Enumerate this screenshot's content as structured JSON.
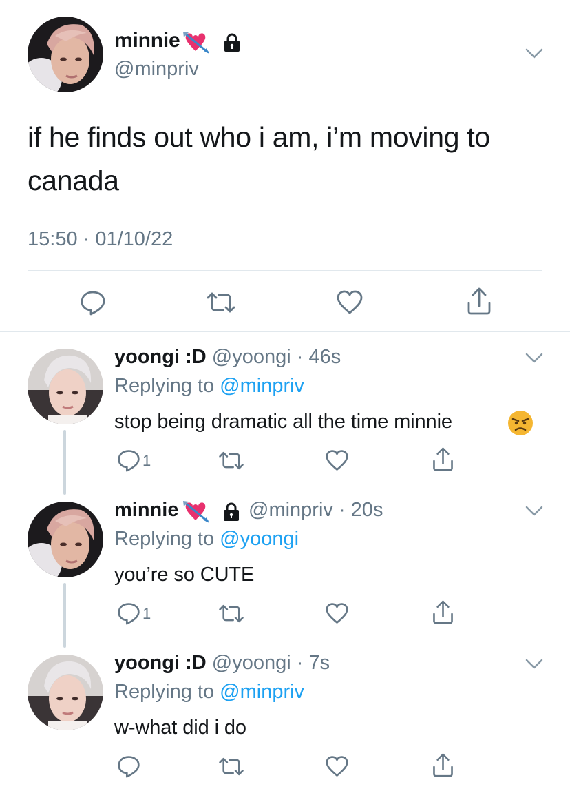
{
  "main": {
    "name": "minnie",
    "handle": "@minpriv",
    "text": "if he finds out who i am, i’m moving to canada",
    "timestamp": "15:50 · 01/10/22",
    "name_emoji": "heart-with-arrow",
    "lock_icon": "lock-icon"
  },
  "replies": [
    {
      "name": "yoongi :D",
      "handle": "@yoongi",
      "time": "· 46s",
      "replying_label": "Replying to",
      "replying_to": "@minpriv",
      "text": "stop being dramatic all the time minnie",
      "text_emoji": "pouting-face",
      "reply_count": "1"
    },
    {
      "name": "minnie",
      "handle": "@minpriv",
      "time": "· 20s",
      "replying_label": "Replying to",
      "replying_to": "@yoongi",
      "text": "you’re so CUTE",
      "reply_count": "1"
    },
    {
      "name": "yoongi :D",
      "handle": "@yoongi",
      "time": "· 7s",
      "replying_label": "Replying to",
      "replying_to": "@minpriv",
      "text": "w-what did i do",
      "reply_count": ""
    }
  ],
  "colors": {
    "accent": "#1da1f2",
    "secondary_text": "#657786",
    "divider": "#e1e8ed",
    "thread_line": "#ccd6dd",
    "heart_emoji": "#e8316e"
  }
}
